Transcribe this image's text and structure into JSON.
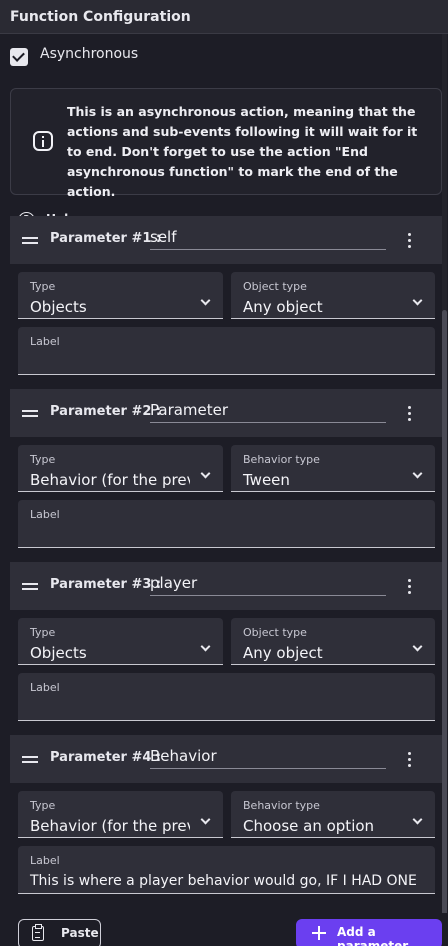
{
  "window": {
    "title": "Function Configuration"
  },
  "async": {
    "label": "Asynchronous",
    "checked": true
  },
  "info": {
    "text": "This is an asynchronous action, meaning that the actions and sub-events following it will wait for it to end. Don't forget to use the action \"End asynchronous function\" to mark the end of the action."
  },
  "help": {
    "label": "Help"
  },
  "parameters": [
    {
      "label": "Parameter #1 :",
      "name": "self",
      "type": {
        "label": "Type",
        "value": "Objects"
      },
      "subtype": {
        "label": "Object type",
        "value": "Any object"
      },
      "field_label": {
        "label": "Label",
        "value": ""
      }
    },
    {
      "label": "Parameter #2 :",
      "name": "Parameter",
      "type": {
        "label": "Type",
        "value": "Behavior (for the previous object)"
      },
      "subtype": {
        "label": "Behavior type",
        "value": "Tween"
      },
      "field_label": {
        "label": "Label",
        "value": ""
      }
    },
    {
      "label": "Parameter #3 :",
      "name": "player",
      "type": {
        "label": "Type",
        "value": "Objects"
      },
      "subtype": {
        "label": "Object type",
        "value": "Any object"
      },
      "field_label": {
        "label": "Label",
        "value": ""
      }
    },
    {
      "label": "Parameter #4 :",
      "name": "Behavior",
      "type": {
        "label": "Type",
        "value": "Behavior (for the previous object)"
      },
      "subtype": {
        "label": "Behavior type",
        "value": "Choose an option"
      },
      "field_label": {
        "label": "Label",
        "value": "This is where a player behavior would go, IF I HAD ONE"
      }
    }
  ],
  "actions": {
    "paste": "Paste",
    "add": "Add a parameter"
  }
}
